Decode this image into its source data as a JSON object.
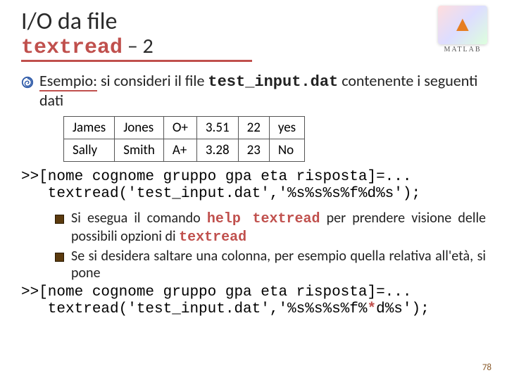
{
  "title": "I/O da file",
  "subtitle_code": "textread",
  "subtitle_rest": " – 2",
  "logo_text": "MATLAB",
  "intro": {
    "lead": "Esempio:",
    "part1": " si consideri il file ",
    "filename": "test_input.dat",
    "part2": " contenente i seguenti dati"
  },
  "table": {
    "rows": [
      [
        "James",
        "Jones",
        "O+",
        "3.51",
        "22",
        "yes"
      ],
      [
        "Sally",
        "Smith",
        "A+",
        "3.28",
        "23",
        "No"
      ]
    ]
  },
  "code1": {
    "line1": ">>[nome cognome gruppo gpa eta risposta]=...",
    "line2": "   textread('test_input.dat','%s%s%s%f%d%s');"
  },
  "sub1": {
    "a": "Si esegua il comando ",
    "cmd": "help textread",
    "b": " per prendere visione delle possibili opzioni di ",
    "cmd2": "textread"
  },
  "sub2": "Se si desidera saltare una colonna, per esempio quella relativa all'età, si pone",
  "code2": {
    "line1": ">>[nome cognome gruppo gpa eta risposta]=...",
    "line2a": "   textread('test_input.dat','%s%s%s%f%",
    "star": "*",
    "line2b": "d%s');"
  },
  "pagenum": "78"
}
